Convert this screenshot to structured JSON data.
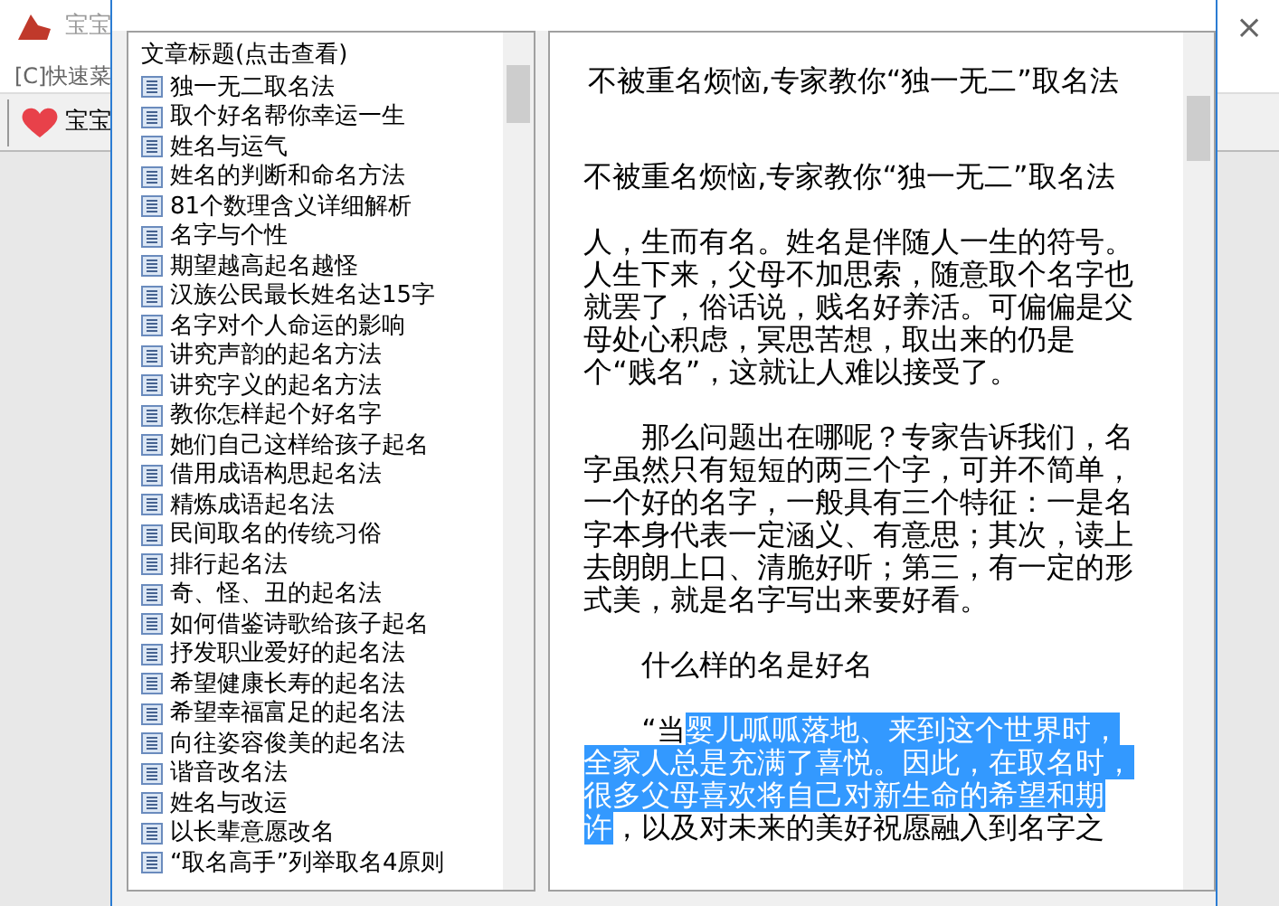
{
  "main_window": {
    "title": "宝宝",
    "menu": "[C]快速菜",
    "toolbar_button": "宝宝",
    "close": "×"
  },
  "list": {
    "header": "文章标题(点击查看)",
    "items": [
      {
        "label": "独一无二取名法"
      },
      {
        "label": "取个好名帮你幸运一生"
      },
      {
        "label": "姓名与运气"
      },
      {
        "label": "姓名的判断和命名方法"
      },
      {
        "label": "81个数理含义详细解析"
      },
      {
        "label": "名字与个性"
      },
      {
        "label": "期望越高起名越怪"
      },
      {
        "label": "汉族公民最长姓名达15字"
      },
      {
        "label": "名字对个人命运的影响"
      },
      {
        "label": "讲究声韵的起名方法"
      },
      {
        "label": "讲究字义的起名方法"
      },
      {
        "label": "教你怎样起个好名字"
      },
      {
        "label": "她们自己这样给孩子起名"
      },
      {
        "label": "借用成语构思起名法"
      },
      {
        "label": "精炼成语起名法"
      },
      {
        "label": "民间取名的传统习俗"
      },
      {
        "label": "排行起名法"
      },
      {
        "label": "奇、怪、丑的起名法"
      },
      {
        "label": "如何借鉴诗歌给孩子起名"
      },
      {
        "label": "抒发职业爱好的起名法"
      },
      {
        "label": "希望健康长寿的起名法"
      },
      {
        "label": "希望幸福富足的起名法"
      },
      {
        "label": "向往姿容俊美的起名法"
      },
      {
        "label": "谐音改名法"
      },
      {
        "label": "姓名与改运"
      },
      {
        "label": "以长辈意愿改名"
      },
      {
        "label": "“取名高手”列举取名4原则"
      }
    ]
  },
  "article": {
    "title": "不被重名烦恼,专家教你“独一无二”取名法",
    "paragraphs": [
      {
        "indent": false,
        "segments": [
          {
            "text": "不被重名烦恼,专家教你“独一无二”取名法",
            "selected": false
          }
        ]
      },
      {
        "indent": false,
        "segments": [
          {
            "text": "人，生而有名。姓名是伴随人一生的符号。人生下来，父母不加思索，随意取个名字也就罢了，俗话说，贱名好养活。可偏偏是父母处心积虑，冥思苦想，取出来的仍是个“贱名”，这就让人难以接受了。",
            "selected": false
          }
        ]
      },
      {
        "indent": true,
        "segments": [
          {
            "text": "那么问题出在哪呢？专家告诉我们，名字虽然只有短短的两三个字，可并不简单，一个好的名字，一般具有三个特征：一是名字本身代表一定涵义、有意思；其次，读上去朗朗上口、清脆好听；第三，有一定的形式美，就是名字写出来要好看。",
            "selected": false
          }
        ]
      },
      {
        "indent": true,
        "segments": [
          {
            "text": "什么样的名是好名",
            "selected": false
          }
        ]
      },
      {
        "indent": true,
        "segments": [
          {
            "text": "“当",
            "selected": false
          },
          {
            "text": "婴儿呱呱落地、来到这个世界时，",
            "selected": true
          },
          {
            "text": "全家人总是充满了喜悦。因此，在取名时，",
            "selected": true
          },
          {
            "text": "很多父母喜欢将自己对新生命的希望和期",
            "selected": true
          },
          {
            "text": "许",
            "selected": true
          },
          {
            "text": "，以及对未来的美好祝愿融入到名字之",
            "selected": false
          }
        ]
      }
    ]
  }
}
